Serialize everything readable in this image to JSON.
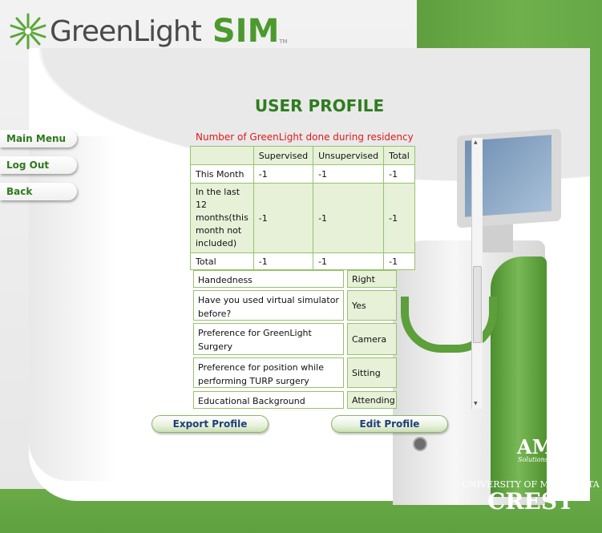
{
  "app": {
    "logo_text": "GreenLight",
    "logo_sim": "SIM",
    "logo_tm": "TM",
    "title": "USER PROFILE"
  },
  "nav": {
    "main_menu": "Main Menu",
    "log_out": "Log Out",
    "back": "Back"
  },
  "residency_caption": "Number of GreenLight done during residency",
  "counts_table": {
    "headers": [
      "",
      "Supervised",
      "Unsupervised",
      "Total"
    ],
    "rows": [
      {
        "label": "This Month",
        "supervised": "-1",
        "unsupervised": "-1",
        "total": "-1"
      },
      {
        "label": "In the last 12 months(this month not included)",
        "supervised": "-1",
        "unsupervised": "-1",
        "total": "-1"
      },
      {
        "label": "Total",
        "supervised": "-1",
        "unsupervised": "-1",
        "total": "-1"
      }
    ]
  },
  "profile": [
    {
      "question": "Handedness",
      "answer": "Right"
    },
    {
      "question": "Have you used virtual simulator before?",
      "answer": "Yes"
    },
    {
      "question": "Preference for GreenLight Surgery",
      "answer": "Camera"
    },
    {
      "question": "Preference for position while performing TURP surgery",
      "answer": "Sitting"
    },
    {
      "question": "Educational Background",
      "answer": "Attending"
    }
  ],
  "buttons": {
    "export_profile": "Export Profile",
    "edit_profile": "Edit Profile"
  },
  "branding": {
    "ams": "AMS",
    "ams_tagline": "Solutions for Life",
    "university": "UNIVERSITY OF MINNESOTA",
    "crest": "CREST"
  },
  "colors": {
    "brand_green": "#4c9a2e",
    "title_green": "#2e7d1e",
    "caption_red": "#e01a1a",
    "button_text": "#1f3f78"
  }
}
